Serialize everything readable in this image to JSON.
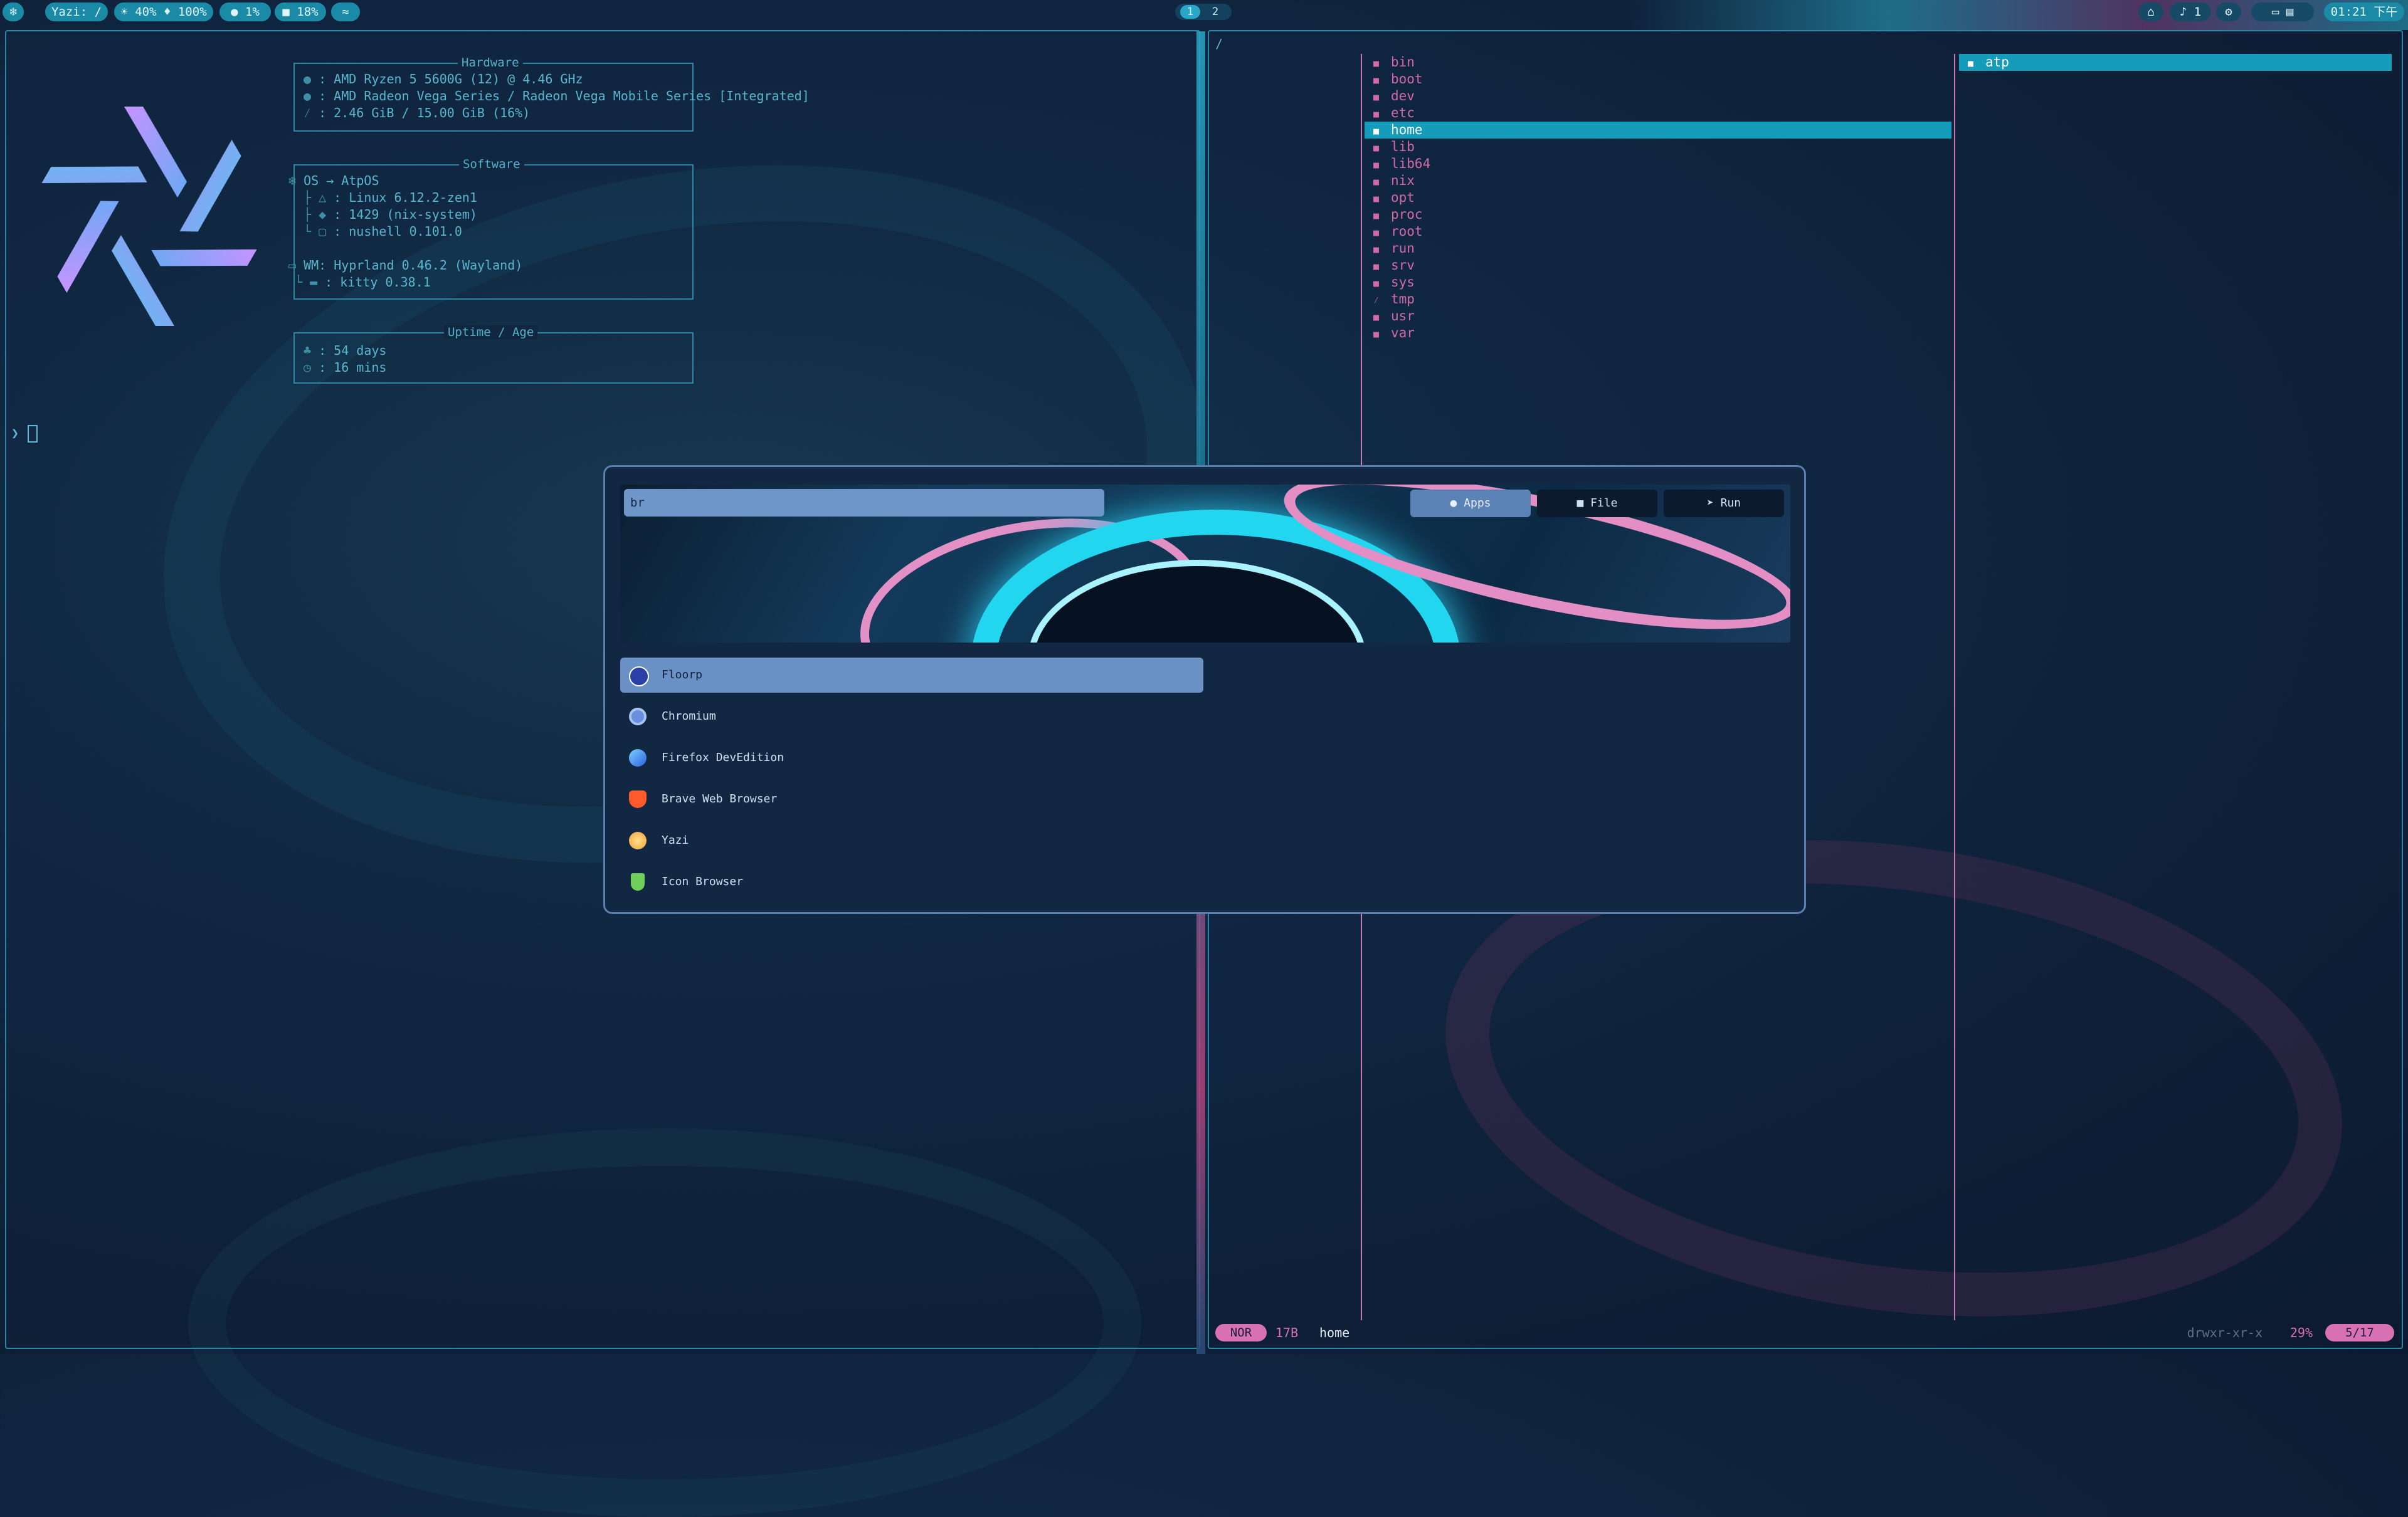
{
  "topbar": {
    "launcher_icon": "nix-snowflake-icon",
    "window_title": "Yazi: /",
    "brightness_volume": "☀ 40% ♦ 100%",
    "cpu": "1%",
    "memory": "18%",
    "extra": "≈",
    "workspaces": [
      "1",
      "2"
    ],
    "tray_notifications": "1",
    "clock": "01:21 下午"
  },
  "fastfetch": {
    "hardware_title": "Hardware",
    "cpu": ": AMD Ryzen 5 5600G (12) @ 4.46 GHz",
    "gpu": ": AMD Radeon Vega Series / Radeon Vega Mobile Series [Integrated]",
    "memory": ": 2.46 GiB / 15.00 GiB (16%)",
    "software_title": "Software",
    "os": "OS → AtpOS",
    "kernel": ": Linux 6.12.2-zen1",
    "packages": ": 1429 (nix-system)",
    "shell": ": nushell 0.101.0",
    "wm": "WM: Hyprland 0.46.2 (Wayland)",
    "terminal": ": kitty 0.38.1",
    "uptime_title": "Uptime / Age",
    "age": ": 54 days",
    "uptime": ": 16 mins"
  },
  "shell": {
    "prompt": "❯"
  },
  "yazi": {
    "path": "/",
    "files": [
      "bin",
      "boot",
      "dev",
      "etc",
      "home",
      "lib",
      "lib64",
      "nix",
      "opt",
      "proc",
      "root",
      "run",
      "srv",
      "sys",
      "tmp",
      "usr",
      "var"
    ],
    "selected": "home",
    "preview": [
      "atp"
    ],
    "status": {
      "mode": "NOR",
      "size": "17B",
      "name": "home",
      "perm": "drwxr-xr-x",
      "pct": "29%",
      "pos": "5/17"
    }
  },
  "launcher": {
    "query": "br",
    "tabs": [
      {
        "label": "Apps",
        "icon": "●"
      },
      {
        "label": "File",
        "icon": "■"
      },
      {
        "label": "Run",
        "icon": "➤"
      }
    ],
    "apps": [
      {
        "name": "Floorp",
        "icon": "floorp-icon",
        "color": "#2a3fa8"
      },
      {
        "name": "Chromium",
        "icon": "chromium-icon",
        "color": "#6a8fe0"
      },
      {
        "name": "Firefox DevEdition",
        "icon": "firefox-devedition-icon",
        "color": "#2f8ff0"
      },
      {
        "name": "Brave Web Browser",
        "icon": "brave-icon",
        "color": "#ff5a2b"
      },
      {
        "name": "Yazi",
        "icon": "yazi-icon",
        "color": "#f0a13a"
      },
      {
        "name": "Icon Browser",
        "icon": "icon-browser-icon",
        "color": "#6fcf5a"
      }
    ]
  },
  "colors": {
    "accent": "#169cbb",
    "pink": "#d870b4",
    "panel": "#122741"
  }
}
